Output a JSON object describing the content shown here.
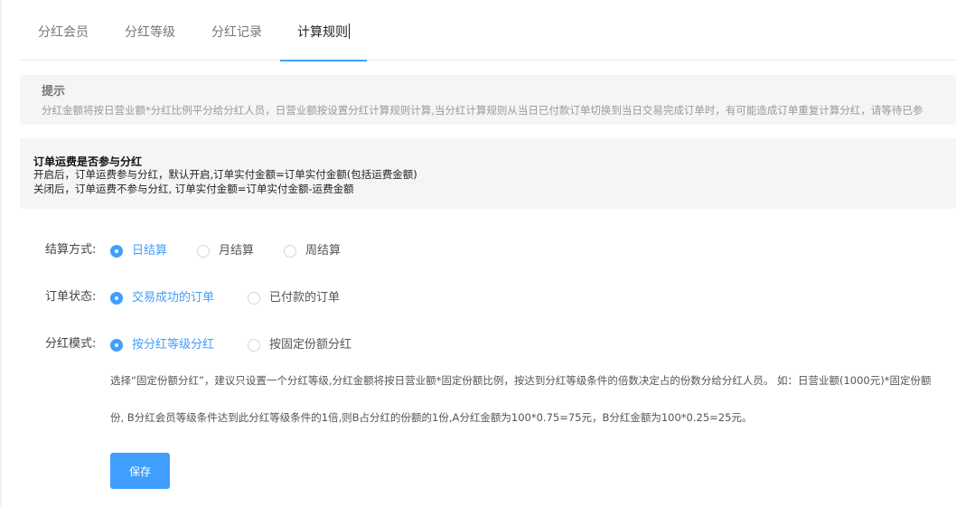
{
  "tabs": [
    {
      "label": "分红会员",
      "active": false
    },
    {
      "label": "分红等级",
      "active": false
    },
    {
      "label": "分红记录",
      "active": false
    },
    {
      "label": "计算规则",
      "active": true
    }
  ],
  "tip": {
    "title": "提示",
    "text": "分红金额将按日营业额*分红比例平分给分红人员，日营业额按设置分红计算规则计算,当分红计算规则从当日已付款订单切换到当日交易完成订单时，有可能造成订单重复计算分红，请等待已参"
  },
  "fee_notice": {
    "title": "订单运费是否参与分红",
    "line1": "开启后，订单运费参与分红，默认开启,订单实付金额=订单实付金额(包括运费金额)",
    "line2": "关闭后，订单运费不参与分红, 订单实付金额=订单实付金额-运费金额"
  },
  "form": {
    "settlement": {
      "label": "结算方式:",
      "options": [
        {
          "label": "日结算",
          "checked": true
        },
        {
          "label": "月结算",
          "checked": false
        },
        {
          "label": "周结算",
          "checked": false
        }
      ]
    },
    "order_status": {
      "label": "订单状态:",
      "options": [
        {
          "label": "交易成功的订单",
          "checked": true
        },
        {
          "label": "已付款的订单",
          "checked": false
        }
      ]
    },
    "dividend_mode": {
      "label": "分红模式:",
      "options": [
        {
          "label": "按分红等级分红",
          "checked": true
        },
        {
          "label": "按固定份额分红",
          "checked": false
        }
      ],
      "description_line1": "选择“固定份额分红”，建议只设置一个分红等级,分红金额将按日营业额*固定份额比例，按达到分红等级条件的倍数决定占的份数分给分红人员。 如：日营业额(1000元)*固定份额",
      "description_line2": "份, B分红会员等级条件达到此分红等级条件的1倍,则B占分红的份额的1份,A分红金额为100*0.75=75元，B分红金额为100*0.25=25元。"
    }
  },
  "save_label": "保存",
  "colors": {
    "accent": "#409eff",
    "panel_bg": "#f4f5f7"
  }
}
